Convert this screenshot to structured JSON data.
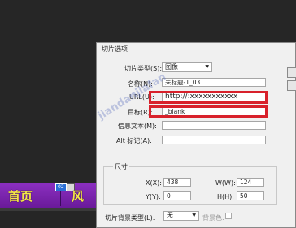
{
  "canvas": {
    "nav": {
      "item1": "首页",
      "item2": "风",
      "slice_tag": "02"
    }
  },
  "dialog": {
    "title": "切片选项",
    "slice_type_label": "切片类型(S):",
    "slice_type_value": "图像",
    "name_label": "名称(N):",
    "name_value": "未标题-1_03",
    "url_label": "URL(U):",
    "url_value": "http://:xxxxxxxxxxx",
    "target_label": "目标(R):",
    "target_value": "_blank",
    "message_label": "信息文本(M):",
    "message_value": "",
    "alt_label": "Alt 标记(A):",
    "alt_value": "",
    "dimensions": {
      "group_title": "尺寸",
      "x_label": "X(X):",
      "x_value": "438",
      "y_label": "Y(Y):",
      "y_value": "0",
      "w_label": "W(W):",
      "w_value": "124",
      "h_label": "H(H):",
      "h_value": "50"
    },
    "bg_type_label": "切片背景类型(L):",
    "bg_type_value": "无",
    "bg_color_label": "背景色:"
  },
  "watermark": "jiandanjiafan"
}
